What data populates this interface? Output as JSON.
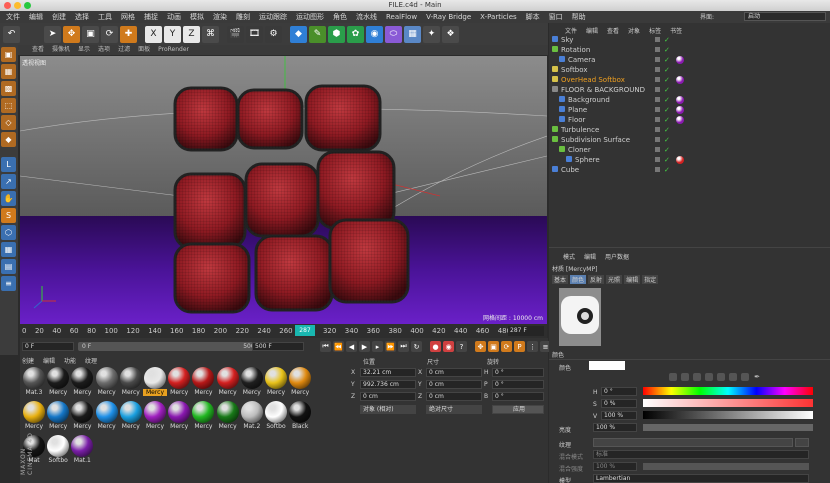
{
  "window": {
    "title": "FILE.c4d - Main"
  },
  "menu": [
    "文件",
    "编辑",
    "创建",
    "选择",
    "工具",
    "网格",
    "捕捉",
    "动画",
    "模拟",
    "渲染",
    "雕刻",
    "运动跟踪",
    "运动图形",
    "角色",
    "流水线",
    "RealFlow",
    "V-Ray Bridge",
    "X-Particles",
    "脚本",
    "窗口",
    "帮助"
  ],
  "layout": {
    "label": "界面:",
    "value": "启动"
  },
  "viewport": {
    "menu": [
      "查看",
      "摄像机",
      "显示",
      "选项",
      "过滤",
      "面板",
      "ProRender"
    ],
    "label": "透视视图",
    "grid_text": "网格间距 : 10000 cm"
  },
  "timeline": {
    "ticks": [
      "0",
      "20",
      "40",
      "60",
      "80",
      "100",
      "120",
      "140",
      "160",
      "180",
      "200",
      "220",
      "240",
      "260",
      "280",
      "320",
      "340",
      "360",
      "380",
      "400",
      "420",
      "440",
      "460",
      "480",
      "500"
    ],
    "current_frame": "287",
    "end_label": "287 F"
  },
  "transport": {
    "start": "0 F",
    "slider_start": "0 F",
    "slider_end": "500 F",
    "end": "500 F"
  },
  "materials": {
    "tabs": [
      "创建",
      "编辑",
      "功能",
      "纹理"
    ],
    "items": [
      {
        "name": "Mat.3",
        "color": "#555555"
      },
      {
        "name": "Mercy",
        "color": "#1c1c1c"
      },
      {
        "name": "Mercy",
        "color": "#1c1c1c"
      },
      {
        "name": "Mercy",
        "color": "#6d6d6d"
      },
      {
        "name": "Mercy",
        "color": "#4a4a4a"
      },
      {
        "name": "Mercy",
        "color": "#e8e8e8"
      },
      {
        "name": "Mercy",
        "color": "#d42020"
      },
      {
        "name": "Mercy",
        "color": "#b81818"
      },
      {
        "name": "Mercy",
        "color": "#d42020"
      },
      {
        "name": "Mercy",
        "color": "#1f1f1f"
      },
      {
        "name": "Mercy",
        "color": "#e8c21a"
      },
      {
        "name": "Mercy",
        "color": "#e08a10"
      },
      {
        "name": "Mercy",
        "color": "#e8b010"
      },
      {
        "name": "Mercy",
        "color": "#1577c8"
      },
      {
        "name": "Mercy",
        "color": "#1a1a1a"
      },
      {
        "name": "Mercy",
        "color": "#1e90e8"
      },
      {
        "name": "Mercy",
        "color": "#1aa0e0"
      },
      {
        "name": "Mercy",
        "color": "#a020c0"
      },
      {
        "name": "Mercy",
        "color": "#8a18b0"
      },
      {
        "name": "Mercy",
        "color": "#22b822"
      },
      {
        "name": "Mercy",
        "color": "#187a18"
      },
      {
        "name": "Mat.2",
        "color": "#bcbcbc"
      },
      {
        "name": "Softbo",
        "color": "#ffffff"
      },
      {
        "name": "Black",
        "color": "#111111"
      },
      {
        "name": "Mat",
        "color": "#151515"
      },
      {
        "name": "Softbo",
        "color": "#ffffff"
      },
      {
        "name": "Mat.1",
        "color": "#7a1fa8"
      }
    ],
    "selected": "Mercy"
  },
  "coords": {
    "headers": [
      "位置",
      "尺寸",
      "旋转"
    ],
    "x": {
      "axis": "X",
      "pos": "32.21 cm",
      "size": "0 cm",
      "rot_axis": "H",
      "rot": "0 °"
    },
    "y": {
      "axis": "Y",
      "pos": "992.736 cm",
      "size": "0 cm",
      "rot_axis": "P",
      "rot": "0 °"
    },
    "z": {
      "axis": "Z",
      "pos": "0 cm",
      "size": "0 cm",
      "rot_axis": "B",
      "rot": "0 °"
    },
    "mode": "对象 (相对)",
    "size_mode": "绝对尺寸",
    "apply": "应用"
  },
  "objects": {
    "menu": [
      "文件",
      "编辑",
      "查看",
      "对象",
      "标签",
      "书签"
    ],
    "rows": [
      {
        "name": "Sky",
        "indent": 0,
        "highlight": false
      },
      {
        "name": "Rotation",
        "indent": 0,
        "highlight": false
      },
      {
        "name": "Camera",
        "indent": 1,
        "highlight": false
      },
      {
        "name": "Softbox",
        "indent": 0,
        "highlight": false
      },
      {
        "name": "OverHead Softbox",
        "indent": 0,
        "highlight": true
      },
      {
        "name": "FLOOR & BACKGROUND",
        "indent": 0,
        "highlight": false
      },
      {
        "name": "Background",
        "indent": 1,
        "highlight": false
      },
      {
        "name": "Plane",
        "indent": 1,
        "highlight": false
      },
      {
        "name": "Floor",
        "indent": 1,
        "highlight": false
      },
      {
        "name": "Turbulence",
        "indent": 0,
        "highlight": false
      },
      {
        "name": "Subdivision Surface",
        "indent": 0,
        "highlight": false
      },
      {
        "name": "Cloner",
        "indent": 1,
        "highlight": false
      },
      {
        "name": "Sphere",
        "indent": 2,
        "highlight": false
      },
      {
        "name": "Cube",
        "indent": 0,
        "highlight": false
      }
    ]
  },
  "attributes": {
    "menu": [
      "模式",
      "编辑",
      "用户数据"
    ],
    "title": "材质 [MercyMP]",
    "tabs": [
      "基本",
      "颜色",
      "反射",
      "光照",
      "编辑",
      "指定"
    ],
    "section": "颜色",
    "color_label": "颜色",
    "h_label": "H",
    "h_value": "0 °",
    "s_label": "S",
    "s_value": "0 %",
    "v_label": "V",
    "v_value": "100 %",
    "brightness_label": "亮度",
    "brightness_value": "100 %",
    "texture_label": "纹理",
    "mix_mode_label": "混合模式",
    "mix_mode_value": "标准",
    "mix_strength_label": "混合强度",
    "mix_strength_value": "100 %",
    "model_label": "模型",
    "model_value": "Lambertian"
  },
  "brand": "MAXON CINEMA 4D"
}
